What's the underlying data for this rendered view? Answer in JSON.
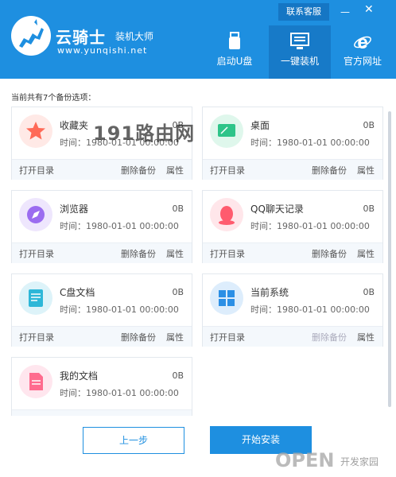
{
  "header": {
    "brand_name": "云骑士",
    "brand_sub": "装机大师",
    "brand_url": "www.yunqishi.net",
    "service_label": "联系客服",
    "minimize_glyph": "—",
    "close_glyph": "✕",
    "nav": [
      {
        "label": "启动U盘",
        "icon": "usb-drive-icon",
        "active": false
      },
      {
        "label": "一键装机",
        "icon": "monitor-icon",
        "active": true
      },
      {
        "label": "官方网址",
        "icon": "ie-browser-icon",
        "active": false
      }
    ],
    "accent_color": "#1e8fe0"
  },
  "backup": {
    "count_text": "当前共有7个备份选项：",
    "items": [
      {
        "name": "收藏夹",
        "size": "0B",
        "time": "时间：1980-01-01 00:00:00",
        "icon": "star-icon",
        "icon_color": "#ff6a57",
        "disabled_actions": false
      },
      {
        "name": "桌面",
        "size": "0B",
        "time": "时间：1980-01-01 00:00:00",
        "icon": "desktop-icon",
        "icon_color": "#2ec489",
        "disabled_actions": false
      },
      {
        "name": "浏览器",
        "size": "0B",
        "time": "时间：1980-01-01 00:00:00",
        "icon": "compass-icon",
        "icon_color": "#9b6cf0",
        "disabled_actions": false
      },
      {
        "name": "QQ聊天记录",
        "size": "0B",
        "time": "时间：1980-01-01 00:00:00",
        "icon": "qq-icon",
        "icon_color": "#ff5b6e",
        "disabled_actions": false
      },
      {
        "name": "C盘文档",
        "size": "0B",
        "time": "时间：1980-01-01 00:00:00",
        "icon": "document-icon",
        "icon_color": "#2db7d8",
        "disabled_actions": false
      },
      {
        "name": "当前系统",
        "size": "0B",
        "time": "时间：1980-01-01 00:00:00",
        "icon": "windows-icon",
        "icon_color": "#2b8fe5",
        "disabled_actions": true
      },
      {
        "name": "我的文档",
        "size": "0B",
        "time": "时间：1980-01-01 00:00:00",
        "icon": "file-icon",
        "icon_color": "#ff6b8e",
        "disabled_actions": false
      }
    ],
    "actions": {
      "open": "打开目录",
      "delete": "删除备份",
      "props": "属性"
    }
  },
  "footer": {
    "prev_label": "上一步",
    "install_label": "开始安装"
  },
  "watermark": {
    "top": "191路由网",
    "bottom": "OPEN",
    "bottom_small": "开发家园"
  }
}
